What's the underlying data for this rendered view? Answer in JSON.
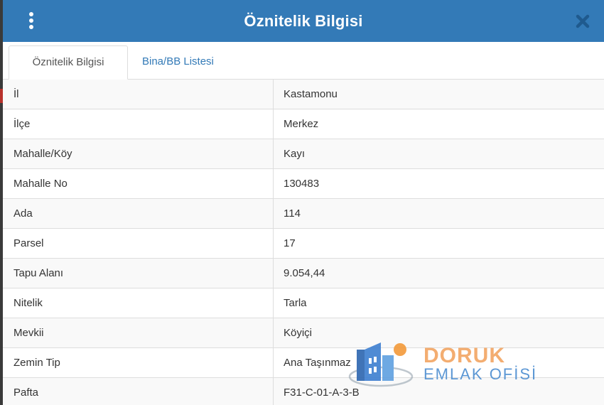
{
  "dialog": {
    "title": "Öznitelik Bilgisi"
  },
  "tabs": [
    {
      "label": "Öznitelik Bilgisi",
      "active": true
    },
    {
      "label": "Bina/BB Listesi",
      "active": false
    }
  ],
  "rows": [
    {
      "key": "İl",
      "value": "Kastamonu"
    },
    {
      "key": "İlçe",
      "value": "Merkez"
    },
    {
      "key": "Mahalle/Köy",
      "value": "Kayı"
    },
    {
      "key": "Mahalle No",
      "value": "130483"
    },
    {
      "key": "Ada",
      "value": "114"
    },
    {
      "key": "Parsel",
      "value": "17"
    },
    {
      "key": "Tapu Alanı",
      "value": "9.054,44"
    },
    {
      "key": "Nitelik",
      "value": "Tarla"
    },
    {
      "key": "Mevkii",
      "value": "Köyiçi"
    },
    {
      "key": "Zemin Tip",
      "value": "Ana Taşınmaz"
    },
    {
      "key": "Pafta",
      "value": "F31-C-01-A-3-B"
    }
  ],
  "watermark": {
    "brand": "DORUK",
    "tagline": "EMLAK OFİSİ"
  },
  "colors": {
    "header": "#337ab7",
    "link": "#337ab7",
    "watermark_orange": "#f2a766",
    "watermark_blue": "#4f8fd1"
  },
  "icons": {
    "menu": "vertical-dots-icon",
    "close": "close-icon",
    "logo": "house-logo-icon"
  }
}
